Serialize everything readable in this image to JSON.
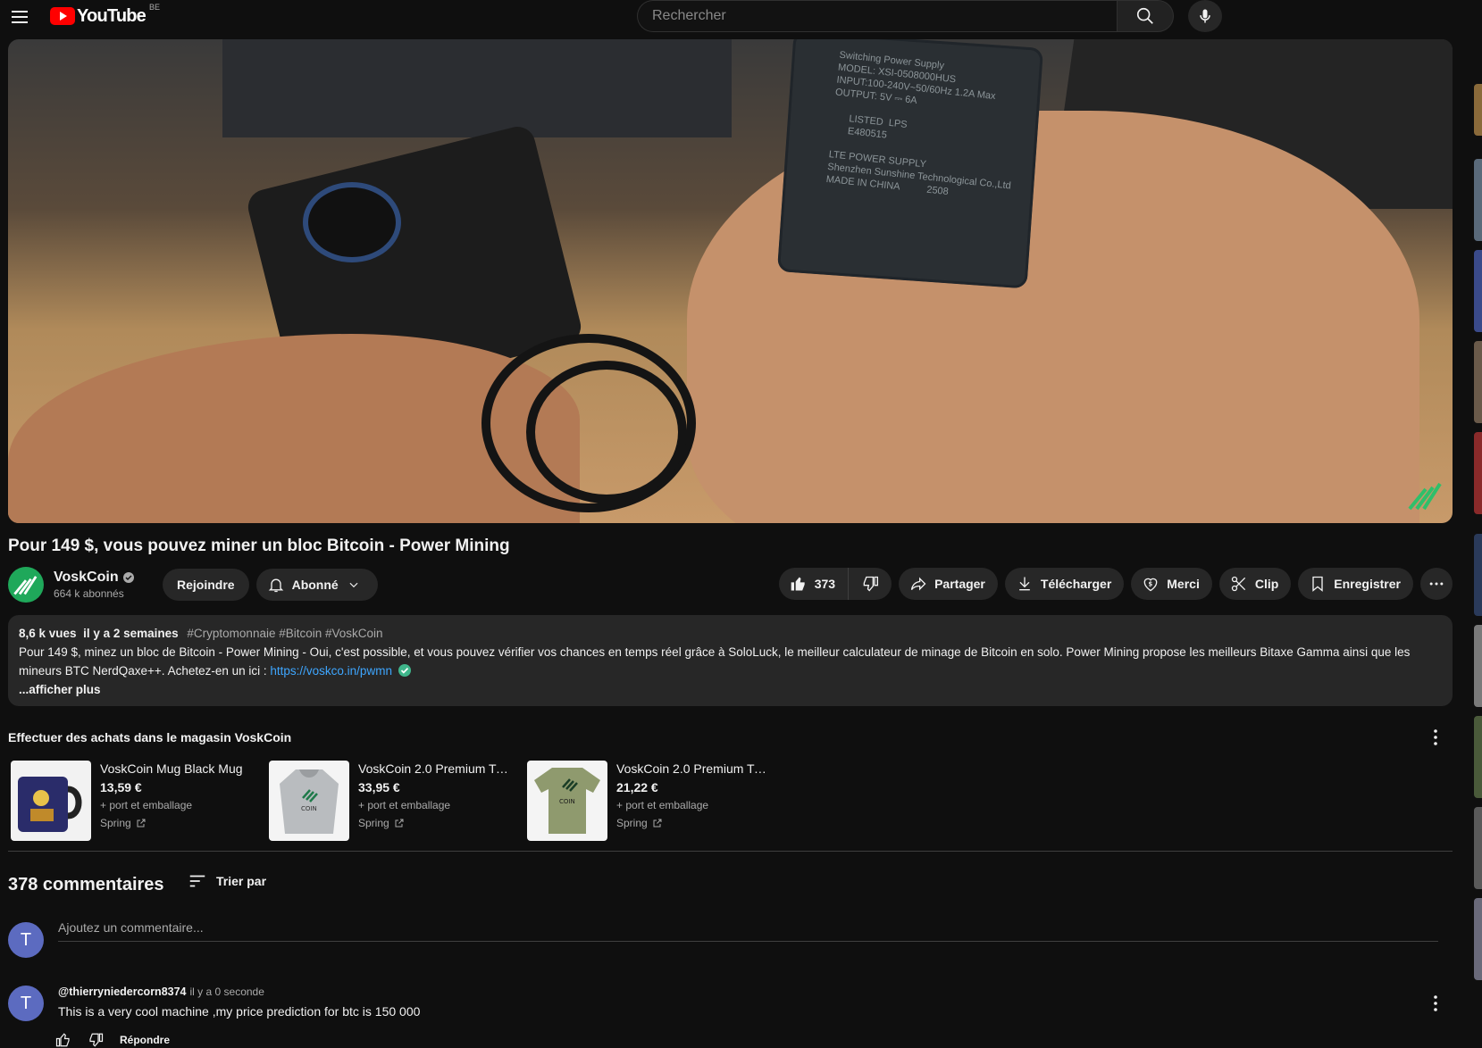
{
  "header": {
    "logo_text": "YouTube",
    "country_code": "BE",
    "search_placeholder": "Rechercher"
  },
  "video": {
    "title": "Pour 149 $, vous pouvez miner un bloc Bitcoin - Power Mining",
    "adapter_print": "Switching Power Supply\nMODEL: XSI-0508000HUS\nINPUT:100-240V~50/60Hz 1.2A Max\nOUTPUT: 5V ⎓ 6A\n\n      LISTED  LPS\n      E480515\n\nLTE POWER SUPPLY\nShenzhen Sunshine Technological Co.,Ltd\nMADE IN CHINA          2508"
  },
  "channel": {
    "name": "VoskCoin",
    "subscribers": "664 k abonnés",
    "join_label": "Rejoindre",
    "subscribed_label": "Abonné"
  },
  "actions": {
    "likes": "373",
    "share": "Partager",
    "download": "Télécharger",
    "thanks": "Merci",
    "clip": "Clip",
    "save": "Enregistrer"
  },
  "description": {
    "views": "8,6 k vues",
    "date": "il y a 2 semaines",
    "tags": "#Cryptomonnaie #Bitcoin #VoskCoin",
    "text": "Pour 149 $, minez un bloc de Bitcoin - Power Mining - Oui, c'est possible, et vous pouvez vérifier vos chances en temps réel grâce à SoloLuck, le meilleur calculateur de minage de Bitcoin en solo. Power Mining propose les meilleurs Bitaxe Gamma ainsi que les mineurs BTC NerdQaxe++. Achetez-en un ici : ",
    "link": "https://voskco.in/pwmn",
    "show_more": "...afficher plus"
  },
  "merch": {
    "title": "Effectuer des achats dans le magasin VoskCoin",
    "items": [
      {
        "name": "VoskCoin Mug Black Mug",
        "price": "13,59 €",
        "shipping": "+ port et emballage",
        "vendor": "Spring"
      },
      {
        "name": "VoskCoin 2.0 Premium T-S...",
        "price": "33,95 €",
        "shipping": "+ port et emballage",
        "vendor": "Spring"
      },
      {
        "name": "VoskCoin 2.0 Premium T-S...",
        "price": "21,22 €",
        "shipping": "+ port et emballage",
        "vendor": "Spring"
      }
    ],
    "print_label": "COIN"
  },
  "comments": {
    "count": "378 commentaires",
    "sort_label": "Trier par",
    "input_placeholder": "Ajoutez un commentaire...",
    "user_initial": "T",
    "list": [
      {
        "author": "@thierryniedercorn8374",
        "time": "il y a 0 seconde",
        "text": "This is a very cool machine  ,my price prediction for btc is 150 000",
        "initial": "T",
        "reply": "Répondre"
      }
    ]
  },
  "colors": {
    "background": "#0f0f0f",
    "surface": "#272727",
    "accent_link": "#3ea6ff",
    "brand_red": "#ff0000",
    "channel_green": "#1fa85a",
    "user_avatar": "#5c6bc0"
  }
}
